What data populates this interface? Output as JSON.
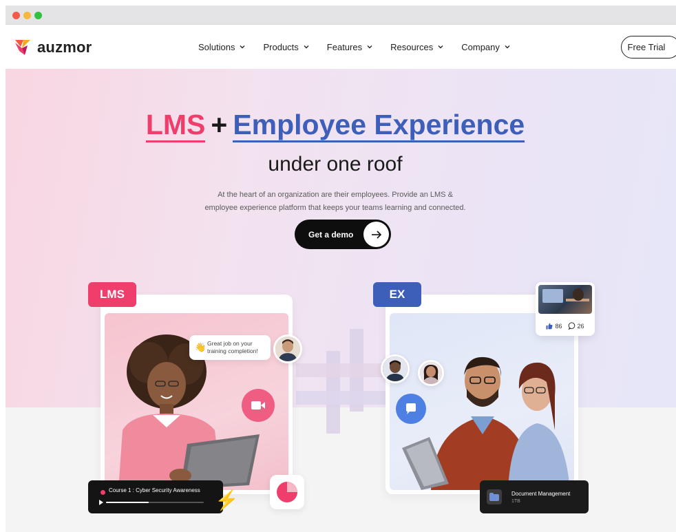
{
  "window": {
    "controls": [
      "close",
      "minimize",
      "maximize"
    ]
  },
  "nav": {
    "logo_text": "auzmor",
    "logo_icon": "auzmor-logo-icon",
    "menu": [
      {
        "label": "Solutions"
      },
      {
        "label": "Products"
      },
      {
        "label": "Features"
      },
      {
        "label": "Resources"
      },
      {
        "label": "Company"
      }
    ],
    "cta_label": "Free Trial"
  },
  "hero": {
    "headline_lms": "LMS",
    "headline_plus": "+",
    "headline_ee": "Employee Experience",
    "subheadline": "under one roof",
    "description": "At the heart of an organization are their employees. Provide an LMS & employee experience platform that keeps your teams learning and connected.",
    "demo_label": "Get a demo"
  },
  "lms_panel": {
    "tag": "LMS",
    "toast_icon": "👋",
    "toast_text": "Great job on your training completion!",
    "video_icon": "video-camera-icon",
    "course": {
      "title": "Course 1 : Cyber Security Awareness",
      "progress": 0.44
    },
    "pie_icon": "pie-chart-icon"
  },
  "ex_panel": {
    "tag": "EX",
    "chat_icon": "chat-bubble-icon",
    "social": {
      "likes": "86",
      "comments": "26"
    },
    "document": {
      "title": "Document Management",
      "size": "1TB"
    }
  },
  "colors": {
    "lms_accent": "#ef3e6c",
    "ex_accent": "#3d5eb9",
    "button_dark": "#0e0e0e",
    "bolt": "#f7a72a"
  }
}
